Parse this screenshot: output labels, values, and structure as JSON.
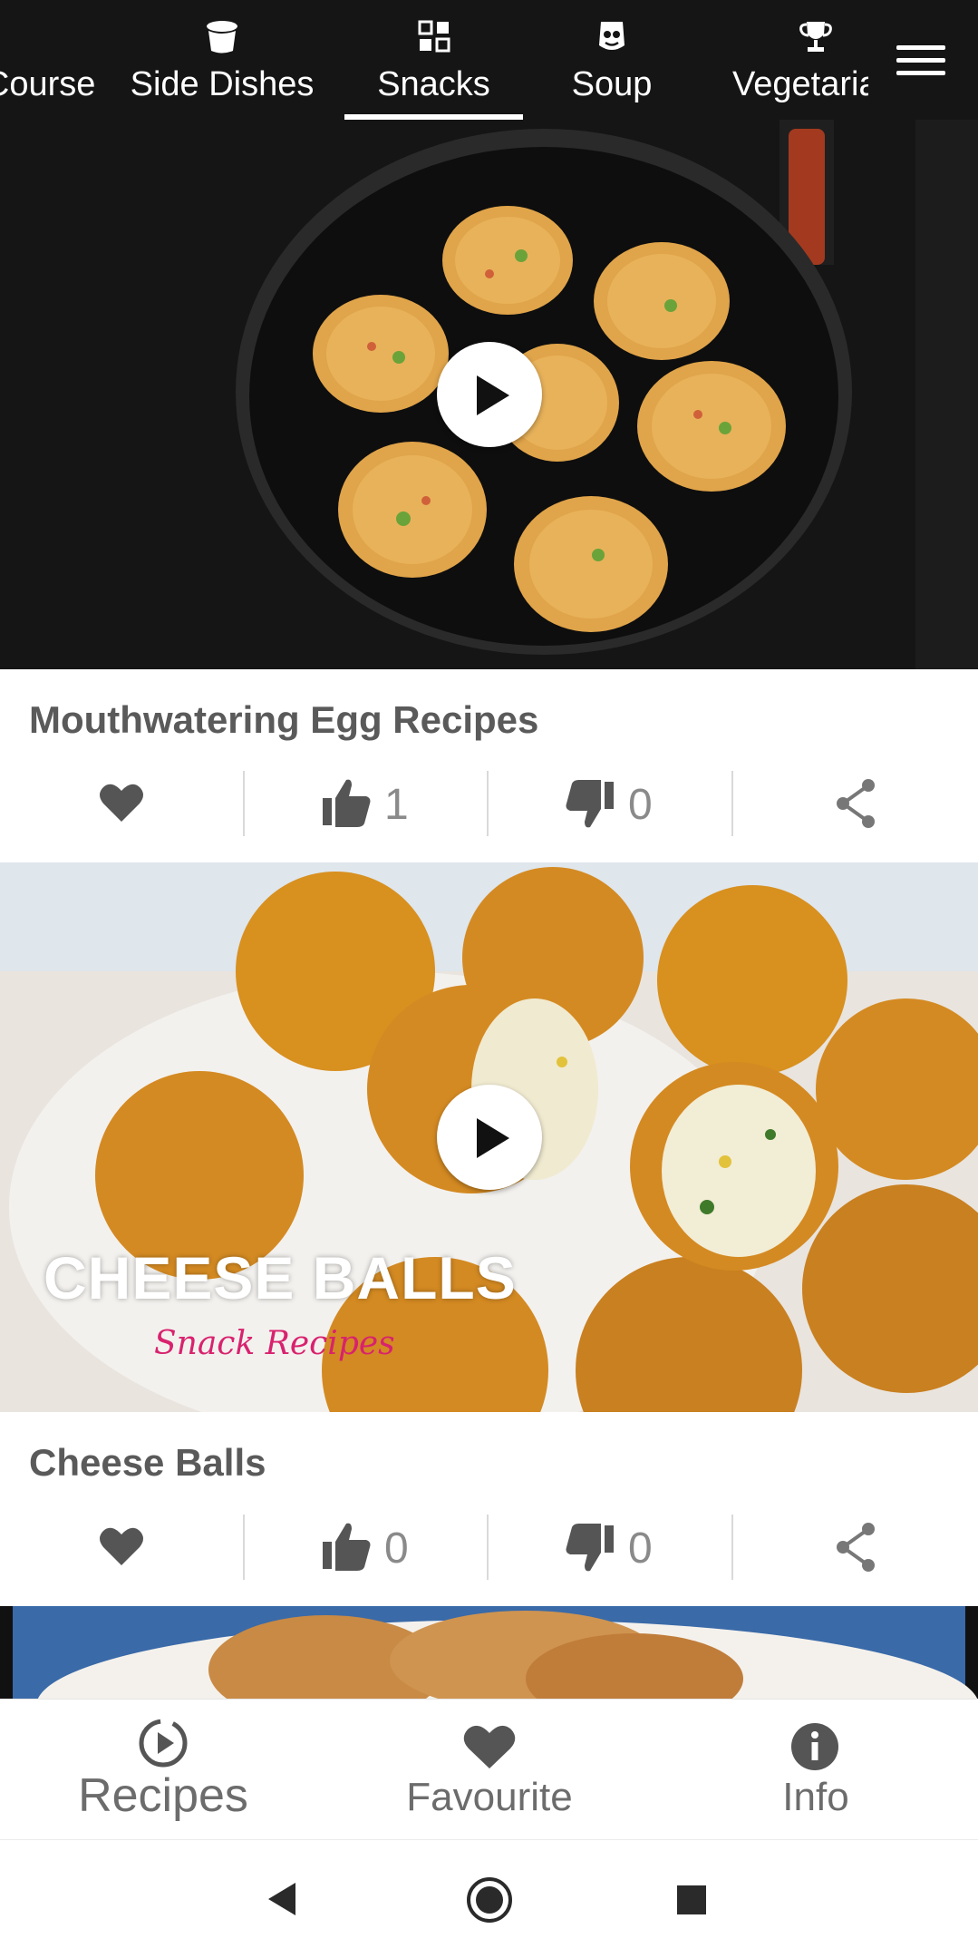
{
  "tabs": [
    {
      "label": "Main Course",
      "icon": "plate-icon"
    },
    {
      "label": "Side Dishes",
      "icon": "pot-icon"
    },
    {
      "label": "Snacks",
      "icon": "grid-icon",
      "selected": true
    },
    {
      "label": "Soup",
      "icon": "soup-face-icon"
    },
    {
      "label": "Vegetarian",
      "icon": "trophy-icon"
    }
  ],
  "cards": [
    {
      "title": "Mouthwatering Egg Recipes",
      "likes": "1",
      "dislikes": "0"
    },
    {
      "title": "Cheese Balls",
      "likes": "0",
      "dislikes": "0",
      "overlay_title": "CHEESE BALLS",
      "overlay_subtitle": "Snack Recipes"
    }
  ],
  "bottom_nav": {
    "recipes": "Recipes",
    "favourite": "Favourite",
    "info": "Info"
  },
  "colors": {
    "topbar": "#151515",
    "text_gray": "#5a5a5a",
    "icon_gray": "#555555"
  }
}
